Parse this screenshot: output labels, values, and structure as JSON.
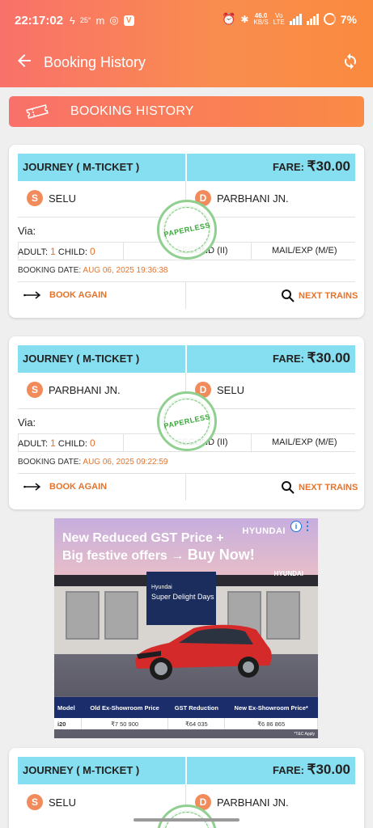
{
  "status_bar": {
    "time": "22:17:02",
    "temp": "25°",
    "carrier_m": "m",
    "speed_value": "46.0",
    "speed_unit": "KB/S",
    "net_top": "Vo",
    "net_bottom": "LTE",
    "battery": "7%"
  },
  "appbar": {
    "title": "Booking History"
  },
  "section": {
    "label": "BOOKING HISTORY"
  },
  "bookings": [
    {
      "journey_type": "JOURNEY ( M-TICKET )",
      "fare_label": "FARE:",
      "fare_amount": "₹30.00",
      "from_code": "S",
      "from": "SELU",
      "to_code": "D",
      "to": "PARBHANI JN.",
      "via": "Via:",
      "adult_label": "ADULT:",
      "adult": "1",
      "child_label": "CHILD:",
      "child": "0",
      "class": "SECOND (II)",
      "train_type": "MAIL/EXP (M/E)",
      "booking_date_label": "BOOKING DATE:",
      "booking_date": "AUG 06, 2025 19:36:38",
      "stamp": "PAPERLESS",
      "book_again": "BOOK AGAIN",
      "next_trains": "NEXT TRAINS"
    },
    {
      "journey_type": "JOURNEY ( M-TICKET )",
      "fare_label": "FARE:",
      "fare_amount": "₹30.00",
      "from_code": "S",
      "from": "PARBHANI JN.",
      "to_code": "D",
      "to": "SELU",
      "via": "Via:",
      "adult_label": "ADULT:",
      "adult": "1",
      "child_label": "CHILD:",
      "child": "0",
      "class": "SECOND (II)",
      "train_type": "MAIL/EXP (M/E)",
      "booking_date_label": "BOOKING DATE:",
      "booking_date": "AUG 06, 2025 09:22:59",
      "stamp": "PAPERLESS",
      "book_again": "BOOK AGAIN",
      "next_trains": "NEXT TRAINS"
    },
    {
      "journey_type": "JOURNEY ( M-TICKET )",
      "fare_label": "FARE:",
      "fare_amount": "₹30.00",
      "from_code": "S",
      "from": "SELU",
      "to_code": "D",
      "to": "PARBHANI JN."
    }
  ],
  "ad": {
    "headline_1": "New Reduced GST Price +",
    "headline_2a": "Big festive offers → ",
    "headline_2b": "Buy Now!",
    "brand": "HYUNDAI",
    "brand_small": "HYUNDAI",
    "sign_small": "Hyundai",
    "sign_big": "Super Delight Days",
    "table_headers": [
      "Model",
      "Old Ex-Showroom Price",
      "GST Reduction",
      "New Ex-Showroom Price*"
    ],
    "table_row": [
      "i20",
      "₹7 50 900",
      "₹64 035",
      "₹6 86 865"
    ],
    "tnc": "*T&C Apply",
    "info": "i",
    "menu": "⋮"
  }
}
